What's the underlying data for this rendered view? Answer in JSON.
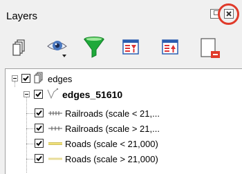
{
  "panel": {
    "title": "Layers"
  },
  "toolbar": {
    "buttons": [
      {
        "name": "add-group-button",
        "icon": "add-group-icon"
      },
      {
        "name": "manage-visibility-button",
        "icon": "eye-dropdown-icon"
      },
      {
        "name": "filter-legend-button",
        "icon": "funnel-icon"
      },
      {
        "name": "expand-all-button",
        "icon": "expand-all-icon"
      },
      {
        "name": "collapse-all-button",
        "icon": "collapse-all-icon"
      },
      {
        "name": "remove-layer-button",
        "icon": "remove-layer-icon"
      }
    ]
  },
  "tree": {
    "group": {
      "label": "edges",
      "checked": true
    },
    "layer": {
      "label": "edges_51610",
      "checked": true
    },
    "rules": [
      {
        "label": "Railroads (scale < 21,...",
        "symbol": "railroad-icon",
        "checked": true
      },
      {
        "label": "Railroads (scale > 21,...",
        "symbol": "railroad-cross-icon",
        "checked": true
      },
      {
        "label": "Roads (scale < 21,000)",
        "symbol": "road-icon",
        "checked": true
      },
      {
        "label": "Roads (scale > 21,000)",
        "symbol": "road-light-icon",
        "checked": true
      }
    ]
  },
  "colors": {
    "highlight": "#e03a2a",
    "funnel": "#1ea93a",
    "road": "#f0e07a"
  }
}
